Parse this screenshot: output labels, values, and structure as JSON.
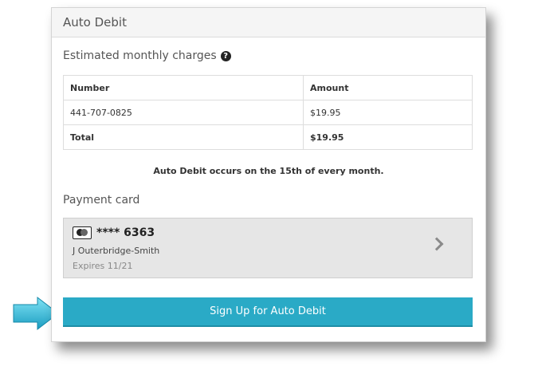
{
  "header": {
    "title": "Auto Debit"
  },
  "charges": {
    "title": "Estimated monthly charges",
    "help_icon": "question-circle-icon",
    "columns": [
      "Number",
      "Amount"
    ],
    "rows": [
      {
        "number": "441-707-0825",
        "amount": "$19.95"
      }
    ],
    "total": {
      "label": "Total",
      "amount": "$19.95"
    }
  },
  "notice": "Auto Debit occurs on the 15th of every month.",
  "payment": {
    "title": "Payment card",
    "card_icon": "credit-card-icon",
    "card_number": "**** 6363",
    "holder": "J Outerbridge-Smith",
    "expires": "Expires 11/21",
    "chevron_icon": "chevron-right-icon"
  },
  "signup_button": "Sign Up for Auto Debit",
  "colors": {
    "accent": "#2aaac6",
    "arrow": "#2bb8d8"
  }
}
